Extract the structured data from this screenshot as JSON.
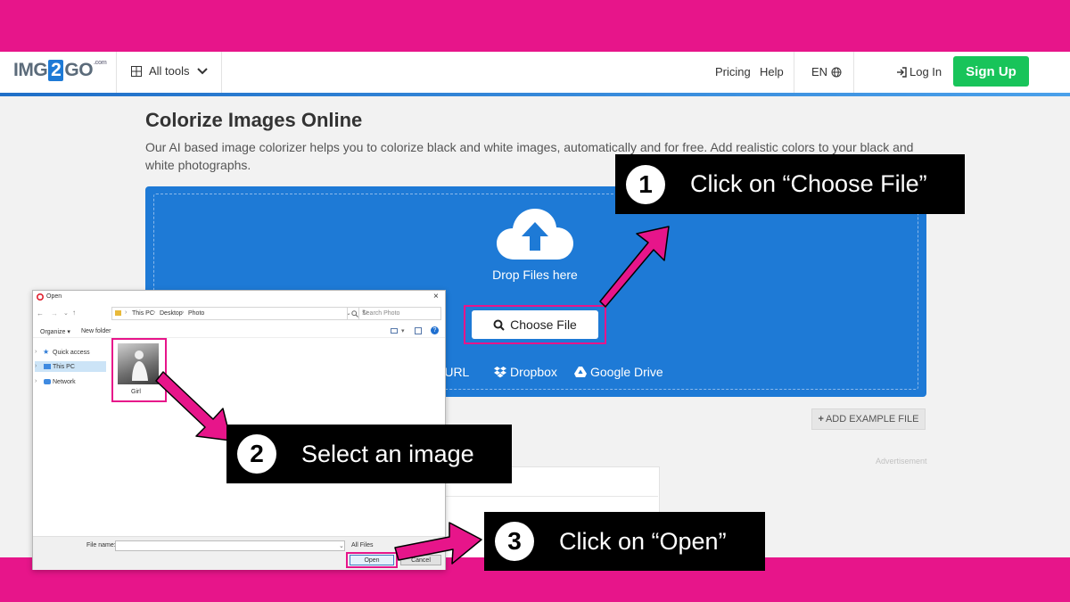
{
  "brand": {
    "logo_pre": "IMG",
    "logo_num": "2",
    "logo_post": "GO",
    "logo_suffix": ".com"
  },
  "nav": {
    "all_tools": "All tools",
    "pricing": "Pricing",
    "help": "Help",
    "lang": "EN",
    "login": "Log In",
    "signup": "Sign Up"
  },
  "page": {
    "title": "Colorize Images Online",
    "description": "Our AI based image colorizer helps you to colorize black and white images, automatically and for free. Add realistic colors to your black and white photographs."
  },
  "upload": {
    "drop_label": "Drop Files here",
    "choose_file": "Choose File",
    "url": "er URL",
    "dropbox": "Dropbox",
    "gdrive": "Google Drive"
  },
  "add_example": "ADD EXAMPLE FILE",
  "advertisement": "Advertisement",
  "dialog": {
    "title": "Open",
    "path": [
      "This PC",
      "Desktop",
      "Photo"
    ],
    "search_placeholder": "Search Photo",
    "organize": "Organize ▾",
    "new_folder": "New folder",
    "nav": [
      "Quick access",
      "This PC",
      "Network"
    ],
    "file_name": "Girl",
    "file_name_label": "File name:",
    "filter": "All Files",
    "open": "Open",
    "cancel": "Cancel"
  },
  "callouts": [
    {
      "num": "1",
      "text": "Click on “Choose File”"
    },
    {
      "num": "2",
      "text": "Select an image"
    },
    {
      "num": "3",
      "text": "Click on “Open”"
    }
  ],
  "colors": {
    "accent_pink": "#e7158a",
    "upload_blue": "#1e7ad6",
    "signup_green": "#18c45a"
  }
}
